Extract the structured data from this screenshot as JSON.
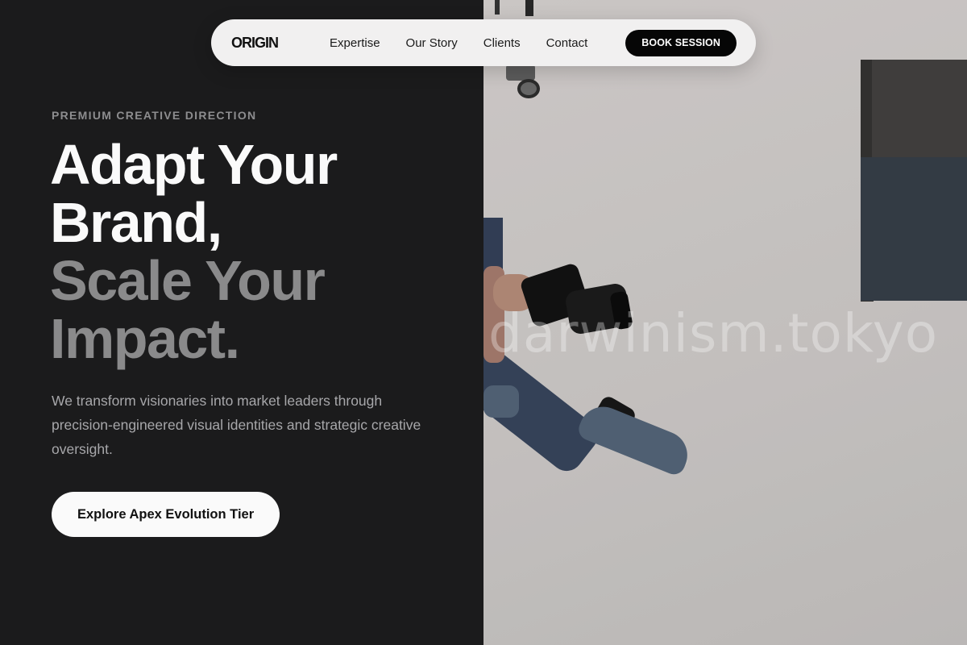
{
  "nav": {
    "brand": "ORIGIN",
    "links": [
      "Expertise",
      "Our Story",
      "Clients",
      "Contact"
    ],
    "cta": "BOOK SESSION"
  },
  "hero": {
    "eyebrow": "PREMIUM CREATIVE DIRECTION",
    "headline_line1": "Adapt Your",
    "headline_line2": "Brand,",
    "headline_line3": "Scale Your",
    "headline_line4": "Impact.",
    "description": "We transform visionaries into market leaders through precision-engineered visual identities and strategic creative oversight.",
    "cta": "Explore Apex Evolution Tier"
  },
  "image": {
    "watermark": "darwinism.tokyo"
  },
  "colors": {
    "left_bg": "#1b1b1c",
    "nav_bg": "#f1f0f0",
    "accent_dark": "#060606",
    "headline_white": "#fafafa",
    "headline_gray": "#8a8a8b"
  }
}
